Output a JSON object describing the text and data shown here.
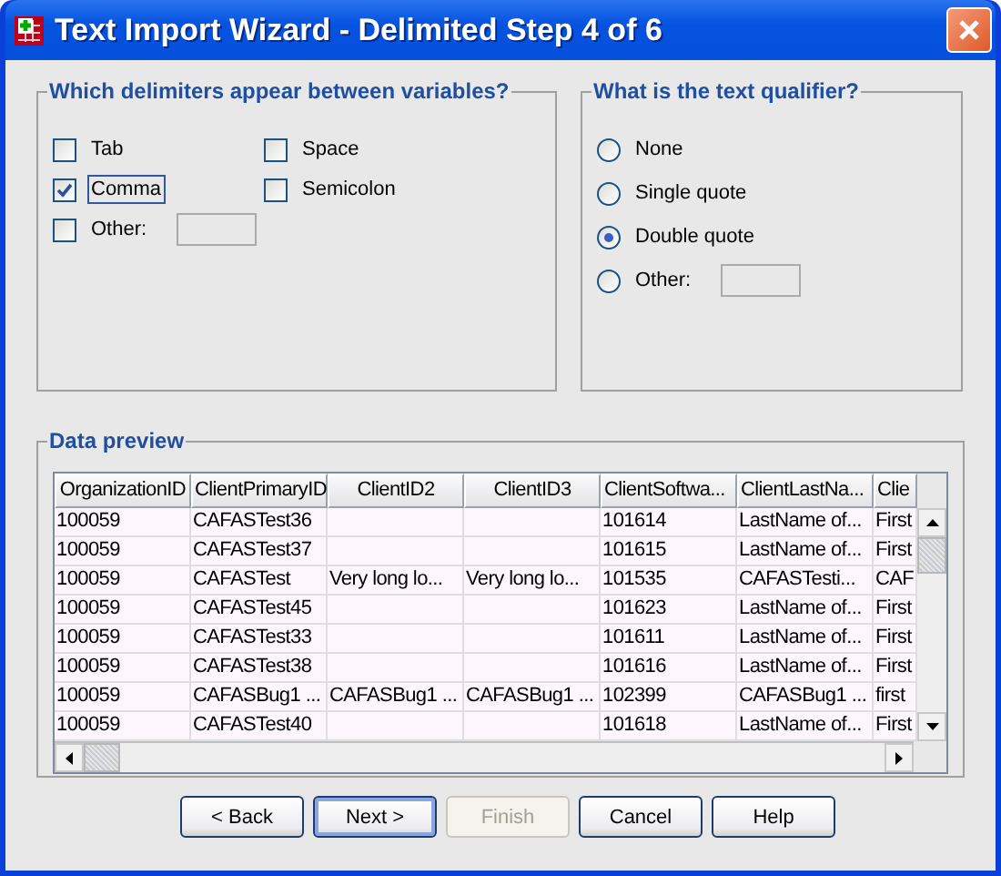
{
  "window": {
    "title": "Text Import Wizard - Delimited Step 4 of 6"
  },
  "delimiters": {
    "title": "Which delimiters appear between variables?",
    "options": [
      {
        "label": "Tab",
        "checked": false,
        "focused": false
      },
      {
        "label": "Space",
        "checked": false,
        "focused": false
      },
      {
        "label": "Comma",
        "checked": true,
        "focused": true
      },
      {
        "label": "Semicolon",
        "checked": false,
        "focused": false
      },
      {
        "label": "Other:",
        "checked": false,
        "focused": false,
        "kind": "with_field"
      }
    ]
  },
  "qualifier": {
    "title": "What is the text qualifier?",
    "options": [
      {
        "label": "None",
        "selected": false
      },
      {
        "label": "Single quote",
        "selected": false
      },
      {
        "label": "Double quote",
        "selected": true
      },
      {
        "label": "Other:",
        "selected": false,
        "kind": "with_field"
      }
    ]
  },
  "preview": {
    "title": "Data preview",
    "columns": [
      "OrganizationID",
      "ClientPrimaryID",
      "ClientID2",
      "ClientID3",
      "ClientSoftwa...",
      "ClientLastNa...",
      "Clie"
    ],
    "rows": [
      [
        "100059",
        "CAFASTest36",
        null,
        null,
        "101614",
        "LastName of...",
        "First"
      ],
      [
        "100059",
        "CAFASTest37",
        null,
        null,
        "101615",
        "LastName of...",
        "First"
      ],
      [
        "100059",
        "CAFASTest",
        "Very long lo...",
        "Very long lo...",
        "101535",
        "CAFASTesti...",
        "CAF"
      ],
      [
        "100059",
        "CAFASTest45",
        null,
        null,
        "101623",
        "LastName of...",
        "First"
      ],
      [
        "100059",
        "CAFASTest33",
        null,
        null,
        "101611",
        "LastName of...",
        "First"
      ],
      [
        "100059",
        "CAFASTest38",
        null,
        null,
        "101616",
        "LastName of...",
        "First"
      ],
      [
        "100059",
        "CAFASBug1 ...",
        "CAFASBug1 ...",
        "CAFASBug1 ...",
        "102399",
        "CAFASBug1 ...",
        "first"
      ],
      [
        "100059",
        "CAFASTest40",
        null,
        null,
        "101618",
        "LastName of...",
        "First"
      ]
    ]
  },
  "buttons": [
    {
      "label": "< Back",
      "disabled": false,
      "default": false
    },
    {
      "label": "Next >",
      "disabled": false,
      "default": true
    },
    {
      "label": "Finish",
      "disabled": true,
      "default": false
    },
    {
      "label": "Cancel",
      "disabled": false,
      "default": false
    },
    {
      "label": "Help",
      "disabled": false,
      "default": false
    }
  ]
}
